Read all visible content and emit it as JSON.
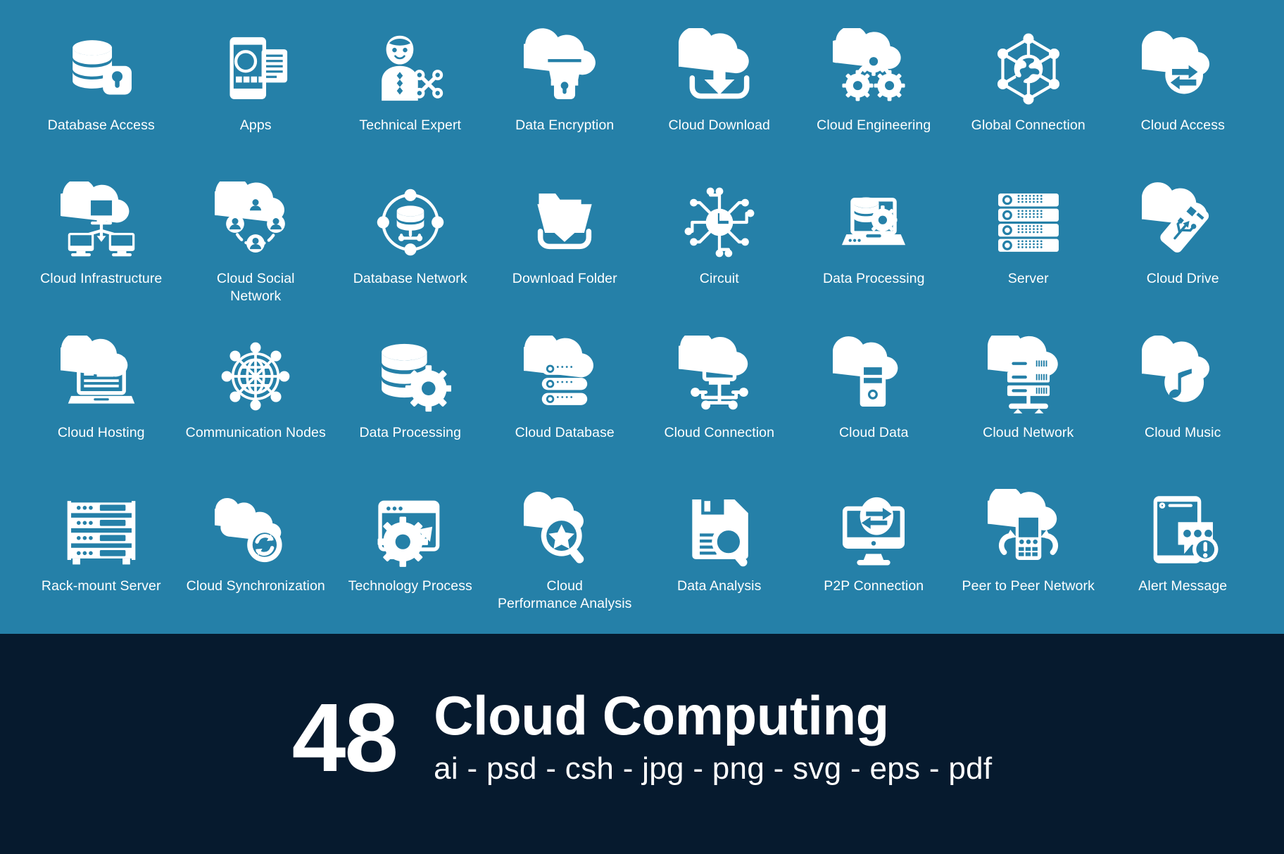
{
  "theme": {
    "background_color": "#2580a8",
    "icon_color": "#ffffff",
    "banner_background_color": "#061a2e",
    "banner_text_color": "#ffffff"
  },
  "grid": {
    "columns": 8,
    "rows": 4,
    "icons": [
      {
        "icon": "database-lock-icon",
        "label": "Database Access"
      },
      {
        "icon": "mobile-apps-icon",
        "label": "Apps"
      },
      {
        "icon": "technical-expert-icon",
        "label": "Technical Expert"
      },
      {
        "icon": "cloud-folder-lock-icon",
        "label": "Data Encryption"
      },
      {
        "icon": "cloud-download-icon",
        "label": "Cloud Download"
      },
      {
        "icon": "cloud-gears-icon",
        "label": "Cloud Engineering"
      },
      {
        "icon": "globe-hexagon-network-icon",
        "label": "Global Connection"
      },
      {
        "icon": "cloud-transfer-arrows-icon",
        "label": "Cloud Access"
      },
      {
        "icon": "cloud-monitors-icon",
        "label": "Cloud Infrastructure"
      },
      {
        "icon": "cloud-users-network-icon",
        "label": "Cloud Social\nNetwork"
      },
      {
        "icon": "database-orbit-icon",
        "label": "Database Network"
      },
      {
        "icon": "download-folder-icon",
        "label": "Download Folder"
      },
      {
        "icon": "circuit-icon",
        "label": "Circuit"
      },
      {
        "icon": "laptop-database-gear-icon",
        "label": "Data Processing"
      },
      {
        "icon": "server-rack-icon",
        "label": "Server"
      },
      {
        "icon": "cloud-usb-drive-icon",
        "label": "Cloud Drive"
      },
      {
        "icon": "cloud-laptop-icon",
        "label": "Cloud Hosting"
      },
      {
        "icon": "globe-nodes-icon",
        "label": "Communication Nodes"
      },
      {
        "icon": "database-gear-icon",
        "label": "Data Processing"
      },
      {
        "icon": "cloud-server-stack-icon",
        "label": "Cloud Database"
      },
      {
        "icon": "cloud-monitor-nodes-icon",
        "label": "Cloud Connection"
      },
      {
        "icon": "cloud-tower-pc-icon",
        "label": "Cloud Data"
      },
      {
        "icon": "cloud-server-network-icon",
        "label": "Cloud Network"
      },
      {
        "icon": "cloud-music-note-icon",
        "label": "Cloud Music"
      },
      {
        "icon": "rack-mount-server-icon",
        "label": "Rack-mount Server"
      },
      {
        "icon": "cloud-sync-icon",
        "label": "Cloud Synchronization"
      },
      {
        "icon": "browser-gear-arrow-icon",
        "label": "Technology Process"
      },
      {
        "icon": "cloud-star-search-icon",
        "label": "Cloud\nPerformance Analysis"
      },
      {
        "icon": "floppy-search-icon",
        "label": "Data Analysis"
      },
      {
        "icon": "monitor-transfer-icon",
        "label": "P2P Connection"
      },
      {
        "icon": "cloud-phone-sync-icon",
        "label": "Peer to Peer Network"
      },
      {
        "icon": "tablet-alert-message-icon",
        "label": "Alert Message"
      }
    ]
  },
  "banner": {
    "count": "48",
    "title": "Cloud Computing",
    "formats": "ai - psd - csh - jpg - png - svg - eps - pdf"
  }
}
